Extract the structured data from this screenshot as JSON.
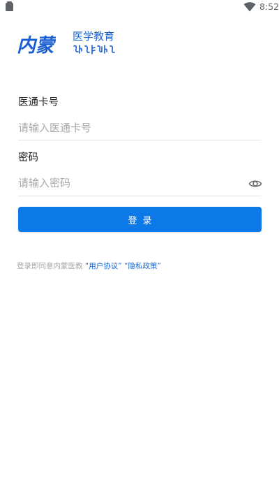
{
  "status_bar": {
    "time": "8:52",
    "left_icon": "sim-card-icon",
    "wifi_icon": "wifi-icon"
  },
  "logo": {
    "mark_text": "内蒙",
    "title": "医学教育",
    "script_icon": "mongolian-script-logo"
  },
  "card_field": {
    "label": "医通卡号",
    "placeholder": "请输入医通卡号",
    "value": ""
  },
  "password_field": {
    "label": "密码",
    "placeholder": "请输入密码",
    "value": "",
    "toggle_icon": "eye-icon"
  },
  "login_button": {
    "label": "登录"
  },
  "agreement": {
    "prefix": "登录即同意内蒙医教",
    "user_agreement": "“用户协议”",
    "privacy_policy": "“隐私政策”"
  },
  "colors": {
    "primary": "#0d78e7",
    "link": "#1a66c8",
    "logo": "#1a5fd0",
    "placeholder": "#a9a9a9",
    "divider": "#e3e3e3"
  }
}
